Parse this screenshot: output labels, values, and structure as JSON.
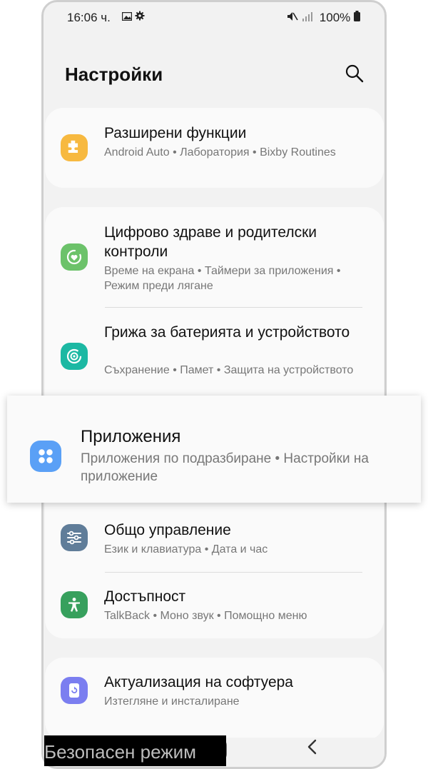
{
  "status_bar": {
    "time": "16:06 ч.",
    "battery": "100%",
    "icons": [
      "image-icon",
      "gear-icon",
      "mute-icon",
      "signal-icon",
      "battery-icon"
    ]
  },
  "header": {
    "title": "Настройки",
    "search_icon": "search-icon"
  },
  "cards": {
    "advanced": {
      "title": "Разширени функции",
      "subtitle": "Android Auto  •  Лаборатория  •  Bixby Routines",
      "icon": "puzzle-icon",
      "color": "#f7b940"
    },
    "wellbeing": {
      "title": "Цифрово здраве и родителски контроли",
      "subtitle": "Време на екрана  •  Таймери за приложения  •  Режим преди лягане",
      "icon": "wellbeing-icon",
      "color": "#6cc26a"
    },
    "battery": {
      "title": "Грижа за батерията и устройството",
      "subtitle": "Съхранение  •  Памет  •  Защита на устройството",
      "icon": "device-care-icon",
      "color": "#1cb8a3"
    },
    "general": {
      "title": "Общо управление",
      "subtitle": "Език и клавиатура  •  Дата и час",
      "icon": "sliders-icon",
      "color": "#607d99"
    },
    "accessibility": {
      "title": "Достъпност",
      "subtitle": "TalkBack  •  Моно звук  •  Помощно меню",
      "icon": "accessibility-icon",
      "color": "#37a05d"
    },
    "update": {
      "title": "Актуализация на софтуера",
      "subtitle": "Изтегляне и инсталиране",
      "icon": "update-icon",
      "color": "#7b7ef0"
    }
  },
  "highlight": {
    "title": "Приложения",
    "subtitle": "Приложения по подразбиране  •  Настройки на приложение",
    "icon": "apps-icon",
    "color": "#5aa0f6"
  },
  "safe_mode": {
    "label": "Безопасен режим"
  },
  "nav": {
    "recent_icon": "recent-apps-icon",
    "home_icon": "home-icon",
    "back_icon": "back-icon"
  }
}
